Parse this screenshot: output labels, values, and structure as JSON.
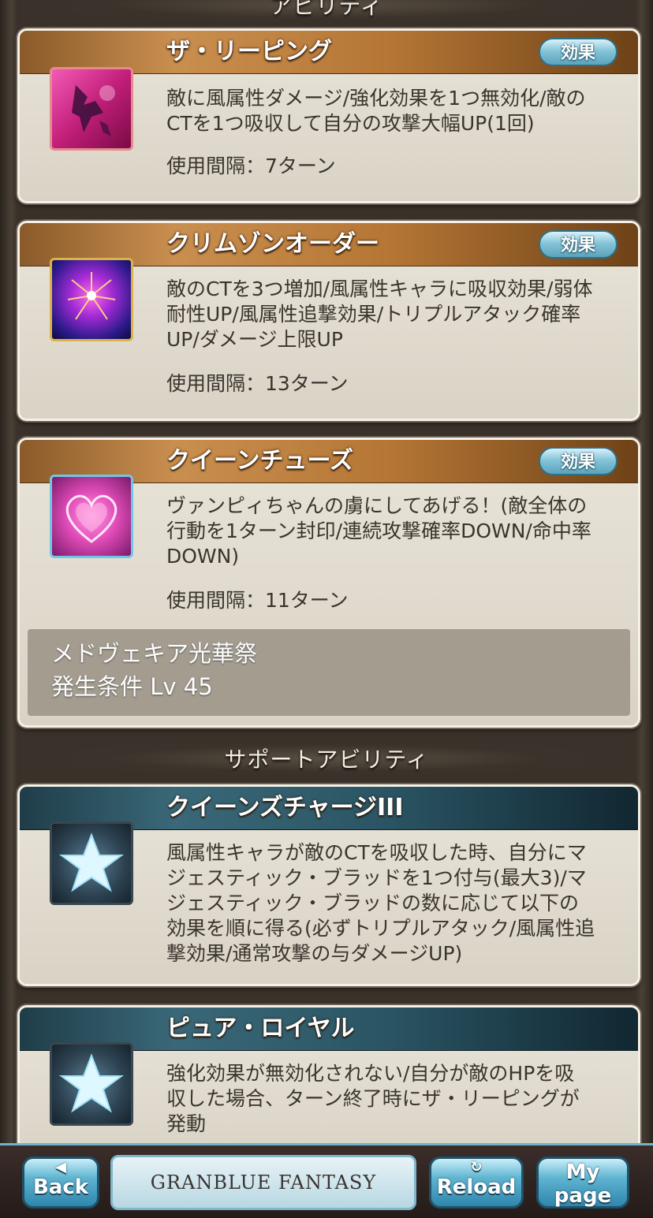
{
  "header_abilities": "アビリティ",
  "header_support": "サポートアビリティ",
  "abilities": [
    {
      "title": "ザ・リーピング",
      "effect_label": "効果",
      "desc": [
        "敵に風属性ダメージ/強化効果を1つ無効化/敵の",
        "CTを1つ吸収して自分の攻撃大幅UP(1回)"
      ],
      "interval": "使用間隔：7ターン",
      "icon": "winged-figure-icon"
    },
    {
      "title": "クリムゾンオーダー",
      "effect_label": "効果",
      "desc": [
        "敵のCTを3つ増加/風属性キャラに吸収効果/弱体",
        "耐性UP/風属性追撃効果/トリプルアタック確率",
        "UP/ダメージ上限UP"
      ],
      "interval": "使用間隔：13ターン",
      "icon": "fireworks-icon"
    },
    {
      "title": "クイーンチューズ",
      "effect_label": "効果",
      "desc": [
        "ヴァンピィちゃんの虜にしてあげる！(敵全体の",
        "行動を1ターン封印/連続攻撃確率DOWN/命中率",
        "DOWN)"
      ],
      "interval": "使用間隔：11ターン",
      "icon": "heart-icon",
      "unlock": {
        "event": "メドヴェキア光華祭",
        "condition": "発生条件 Lv 45"
      }
    }
  ],
  "support": [
    {
      "title": "クイーンズチャージIII",
      "desc": [
        "風属性キャラが敵のCTを吸収した時、自分にマ",
        "ジェスティック・ブラッドを1つ付与(最大3)/マ",
        "ジェスティック・ブラッドの数に応じて以下の",
        "効果を順に得る(必ずトリプルアタック/風属性追",
        "撃効果/通常攻撃の与ダメージUP)"
      ],
      "icon": "star-icon"
    },
    {
      "title": "ピュア・ロイヤル",
      "desc": [
        "強化効果が無効化されない/自分が敵のHPを吸",
        "収した場合、ターン終了時にザ・リーピングが",
        "発動"
      ],
      "icon": "star-icon"
    }
  ],
  "footer": {
    "back_label": "Back",
    "logo_text": "GRANBLUE FANTASY",
    "reload_label": "Reload",
    "mypage_line1": "My",
    "mypage_line2": "page"
  },
  "colors": {
    "ability_bar": "#b57635",
    "support_bar": "#2a5463",
    "card_bg": "#e4dfd3",
    "button_blue": "#5fb4d1"
  }
}
